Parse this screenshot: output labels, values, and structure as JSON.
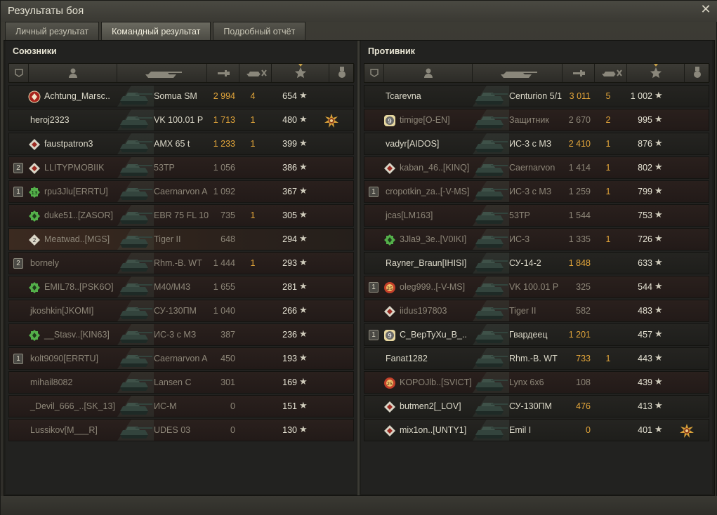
{
  "window": {
    "title": "Результаты боя"
  },
  "tabs": [
    {
      "label": "Личный результат",
      "active": false
    },
    {
      "label": "Командный результат",
      "active": true
    },
    {
      "label": "Подробный отчёт",
      "active": false
    }
  ],
  "colors": {
    "damage": "#e2a53a",
    "dim": "#8a8578",
    "accent": "#c9a34a"
  },
  "columns": [
    "platoon-icon",
    "player-icon",
    "vehicle-icon",
    "damage-icon",
    "kills-icon",
    "xp-icon",
    "medal-icon"
  ],
  "allies": {
    "title": "Союзники",
    "rows": [
      {
        "platoon": "",
        "badge": "red",
        "player": "Achtung_Marsc..",
        "vehicle": "Somua SM",
        "damage": "2 994",
        "kills": "4",
        "xp": "654",
        "dead": false,
        "lowdmg": false,
        "medal": false
      },
      {
        "platoon": "",
        "badge": "",
        "player": "heroj2323",
        "vehicle": "VK 100.01 P",
        "damage": "1 713",
        "kills": "1",
        "xp": "480",
        "dead": false,
        "lowdmg": false,
        "medal": true
      },
      {
        "platoon": "",
        "badge": "white",
        "player": "faustpatron3",
        "vehicle": "AMX 65 t",
        "damage": "1 233",
        "kills": "1",
        "xp": "399",
        "dead": false,
        "lowdmg": false,
        "medal": false
      },
      {
        "platoon": "2",
        "badge": "white",
        "player": "LLIТYPMOBIIK",
        "vehicle": "53TP",
        "damage": "1 056",
        "kills": "",
        "xp": "386",
        "dead": true,
        "lowdmg": true,
        "medal": false
      },
      {
        "platoon": "1",
        "badge": "green13",
        "player": "rpu3Jlu[ERRTU]",
        "vehicle": "Caernarvon A",
        "damage": "1 092",
        "kills": "",
        "xp": "367",
        "dead": true,
        "lowdmg": true,
        "medal": false
      },
      {
        "platoon": "",
        "badge": "green",
        "player": "duke51..[ZASOR]",
        "vehicle": "EBR 75 FL 10",
        "damage": "735",
        "kills": "1",
        "xp": "305",
        "dead": true,
        "lowdmg": true,
        "medal": false
      },
      {
        "platoon": "",
        "badge": "white2",
        "player": "Meatwad..[MGS]",
        "vehicle": "Tiger II",
        "damage": "648",
        "kills": "",
        "xp": "294",
        "dead": true,
        "lowdmg": true,
        "medal": false,
        "hl": true
      },
      {
        "platoon": "2",
        "badge": "",
        "player": "bornely",
        "vehicle": "Rhm.-B. WT",
        "damage": "1 444",
        "kills": "1",
        "xp": "293",
        "dead": true,
        "lowdmg": true,
        "medal": false
      },
      {
        "platoon": "",
        "badge": "green",
        "player": "EMIL78..[PSK6O]",
        "vehicle": "M40/M43",
        "damage": "1 655",
        "kills": "",
        "xp": "281",
        "dead": true,
        "lowdmg": true,
        "medal": false
      },
      {
        "platoon": "",
        "badge": "",
        "player": "jkoshkin[JKOMI]",
        "vehicle": "СУ-130ПМ",
        "damage": "1 040",
        "kills": "",
        "xp": "266",
        "dead": true,
        "lowdmg": true,
        "medal": false
      },
      {
        "platoon": "",
        "badge": "green",
        "player": "__Stasv..[KIN63]",
        "vehicle": "ИС-3 с МЗ",
        "damage": "387",
        "kills": "",
        "xp": "236",
        "dead": true,
        "lowdmg": true,
        "medal": false
      },
      {
        "platoon": "1",
        "badge": "",
        "player": "kolt9090[ERRTU]",
        "vehicle": "Caernarvon A",
        "damage": "450",
        "kills": "",
        "xp": "193",
        "dead": true,
        "lowdmg": true,
        "medal": false
      },
      {
        "platoon": "",
        "badge": "",
        "player": "mihail8082",
        "vehicle": "Lansen C",
        "damage": "301",
        "kills": "",
        "xp": "169",
        "dead": true,
        "lowdmg": true,
        "medal": false
      },
      {
        "platoon": "",
        "badge": "",
        "player": "_Devil_666_..[SK_13]",
        "vehicle": "ИС-М",
        "damage": "0",
        "kills": "",
        "xp": "151",
        "dead": true,
        "lowdmg": true,
        "medal": false
      },
      {
        "platoon": "",
        "badge": "",
        "player": "Lussikov[M___R]",
        "vehicle": "UDES 03",
        "damage": "0",
        "kills": "",
        "xp": "130",
        "dead": true,
        "lowdmg": true,
        "medal": false
      }
    ]
  },
  "enemies": {
    "title": "Противник",
    "rows": [
      {
        "platoon": "",
        "badge": "",
        "player": "Tcarevna",
        "vehicle": "Centurion 5/1",
        "damage": "3 011",
        "kills": "5",
        "xp": "1 002",
        "dead": false,
        "lowdmg": false,
        "medal": false
      },
      {
        "platoon": "",
        "badge": "yellow9",
        "player": "timige[O-EN]",
        "vehicle": "Защитник",
        "damage": "2 670",
        "kills": "2",
        "xp": "995",
        "dead": true,
        "lowdmg": true,
        "medal": false
      },
      {
        "platoon": "",
        "badge": "",
        "player": "vadyr[AIDOS]",
        "vehicle": "ИС-3 с МЗ",
        "damage": "2 410",
        "kills": "1",
        "xp": "876",
        "dead": false,
        "lowdmg": false,
        "medal": false
      },
      {
        "platoon": "",
        "badge": "white",
        "player": "kaban_46..[KINQ]",
        "vehicle": "Caernarvon",
        "damage": "1 414",
        "kills": "1",
        "xp": "802",
        "dead": true,
        "lowdmg": true,
        "medal": false
      },
      {
        "platoon": "1",
        "badge": "",
        "player": "cropotkin_za..[-V-MS]",
        "vehicle": "ИС-3 с МЗ",
        "damage": "1 259",
        "kills": "1",
        "xp": "799",
        "dead": true,
        "lowdmg": true,
        "medal": false
      },
      {
        "platoon": "",
        "badge": "",
        "player": "jcas[LM163]",
        "vehicle": "53TP",
        "damage": "1 544",
        "kills": "",
        "xp": "753",
        "dead": true,
        "lowdmg": true,
        "medal": false
      },
      {
        "platoon": "",
        "badge": "green",
        "player": "3Jla9_3e..[V0IKI]",
        "vehicle": "ИС-3",
        "damage": "1 335",
        "kills": "1",
        "xp": "726",
        "dead": true,
        "lowdmg": true,
        "medal": false
      },
      {
        "platoon": "",
        "badge": "",
        "player": "Rayner_Braun[IHISI]",
        "vehicle": "СУ-14-2",
        "damage": "1 848",
        "kills": "",
        "xp": "633",
        "dead": false,
        "lowdmg": false,
        "medal": false
      },
      {
        "platoon": "1",
        "badge": "red25",
        "player": "oleg999..[-V-MS]",
        "vehicle": "VK 100.01 P",
        "damage": "325",
        "kills": "",
        "xp": "544",
        "dead": true,
        "lowdmg": true,
        "medal": false
      },
      {
        "platoon": "",
        "badge": "white",
        "player": "iidus197803",
        "vehicle": "Tiger II",
        "damage": "582",
        "kills": "",
        "xp": "483",
        "dead": true,
        "lowdmg": true,
        "medal": false
      },
      {
        "platoon": "1",
        "badge": "yellow9",
        "player": "C_BepTyXu_B_..",
        "vehicle": "Гвардеец",
        "damage": "1 201",
        "kills": "",
        "xp": "457",
        "dead": false,
        "lowdmg": false,
        "medal": false
      },
      {
        "platoon": "",
        "badge": "",
        "player": "Fanat1282",
        "vehicle": "Rhm.-B. WT",
        "damage": "733",
        "kills": "1",
        "xp": "443",
        "dead": false,
        "lowdmg": false,
        "medal": false
      },
      {
        "platoon": "",
        "badge": "red25",
        "player": "KOPOJlb..[SVICT]",
        "vehicle": "Lynx 6x6",
        "damage": "108",
        "kills": "",
        "xp": "439",
        "dead": true,
        "lowdmg": true,
        "medal": false
      },
      {
        "platoon": "",
        "badge": "white",
        "player": "butmen2[_LOV]",
        "vehicle": "СУ-130ПМ",
        "damage": "476",
        "kills": "",
        "xp": "413",
        "dead": false,
        "lowdmg": false,
        "medal": false
      },
      {
        "platoon": "",
        "badge": "white",
        "player": "mix1on..[UNTY1]",
        "vehicle": "Emil I",
        "damage": "0",
        "kills": "",
        "xp": "401",
        "dead": false,
        "lowdmg": false,
        "medal": true
      }
    ]
  }
}
